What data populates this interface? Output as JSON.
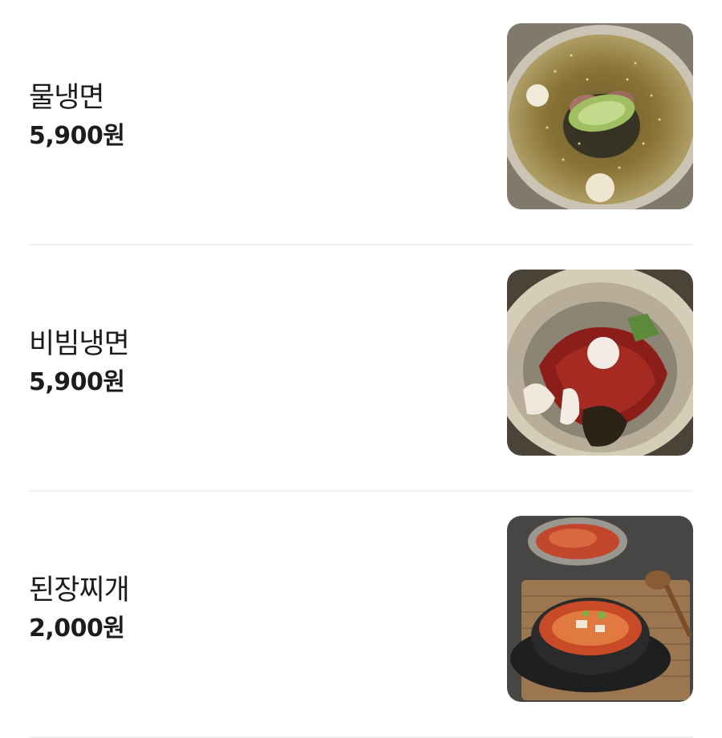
{
  "menu": {
    "items": [
      {
        "name": "물냉면",
        "price": "5,900원",
        "image_icon": "mul-naengmyeon-photo"
      },
      {
        "name": "비빔냉면",
        "price": "5,900원",
        "image_icon": "bibim-naengmyeon-photo"
      },
      {
        "name": "된장찌개",
        "price": "2,000원",
        "image_icon": "doenjang-jjigae-photo"
      }
    ]
  }
}
